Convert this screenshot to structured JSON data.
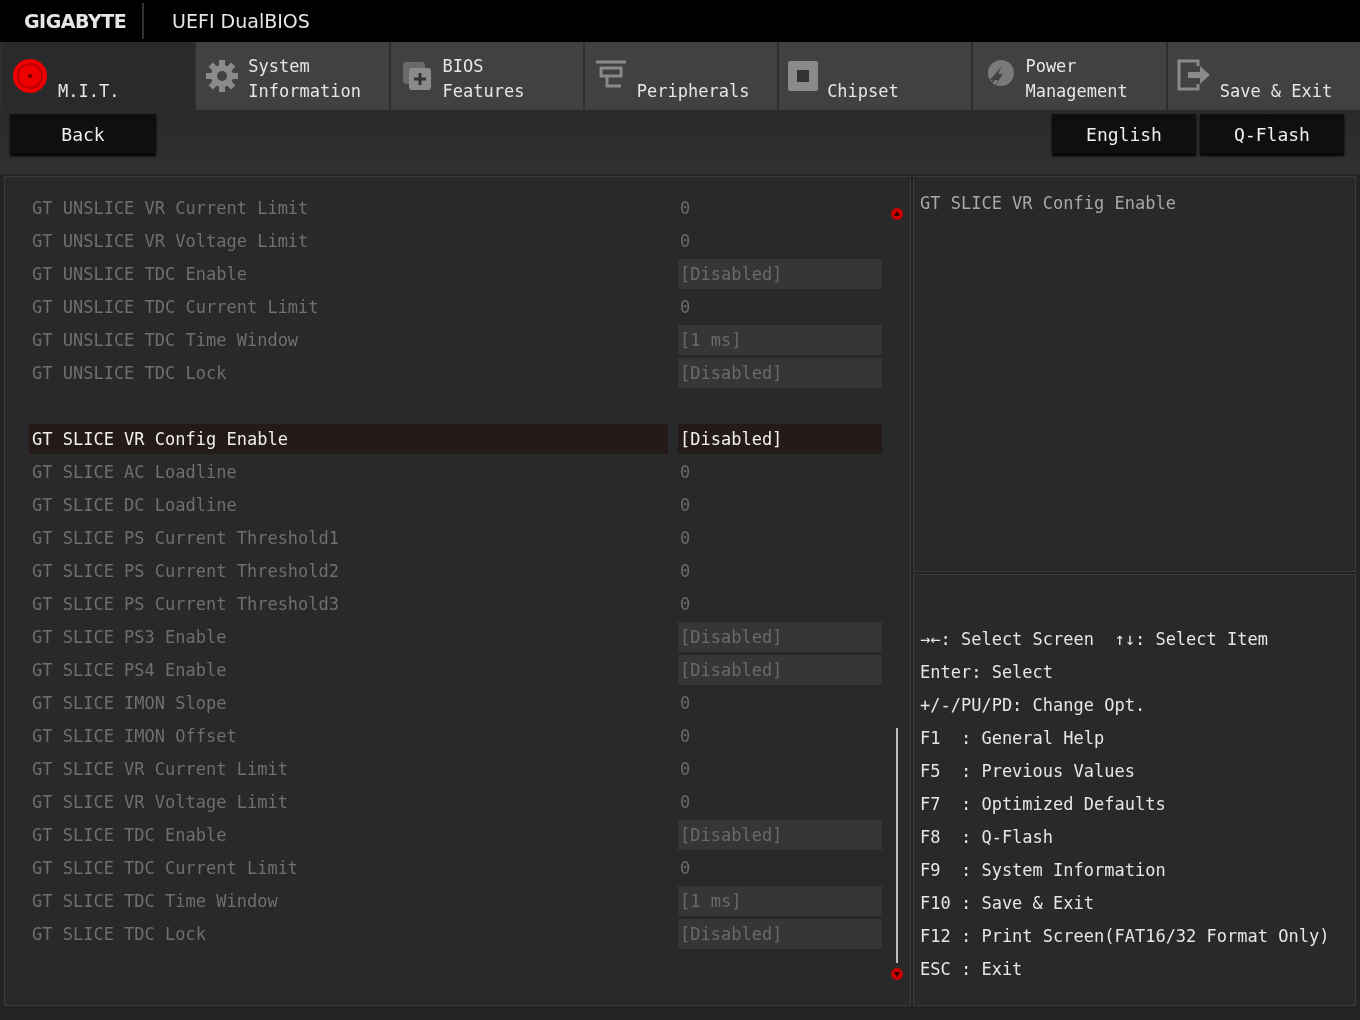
{
  "header": {
    "brand": "GIGABYTE",
    "title": "UEFI DualBIOS"
  },
  "tabs": [
    {
      "kind": "mit",
      "label": "M.I.T.",
      "selected": true
    },
    {
      "kind": "system",
      "label": "System Information",
      "selected": false
    },
    {
      "kind": "bios",
      "label": "BIOS Features",
      "selected": false
    },
    {
      "kind": "peripherals",
      "label": "Peripherals",
      "selected": false
    },
    {
      "kind": "chipset",
      "label": "Chipset",
      "selected": false
    },
    {
      "kind": "power",
      "label": "Power Management",
      "selected": false
    },
    {
      "kind": "exit",
      "label": "Save & Exit",
      "selected": false
    }
  ],
  "back_button": "Back",
  "top_buttons": [
    "English",
    "Q-Flash"
  ],
  "settings": [
    [
      {
        "label": "GT UNSLICE VR Current Limit",
        "value": "0",
        "kind": "number",
        "selected": false
      },
      {
        "label": "GT UNSLICE VR Voltage Limit",
        "value": "0",
        "kind": "number",
        "selected": false
      },
      {
        "label": "GT UNSLICE TDC Enable",
        "value": "[Disabled]",
        "kind": "option",
        "selected": false
      },
      {
        "label": "GT UNSLICE TDC Current Limit",
        "value": "0",
        "kind": "number",
        "selected": false
      },
      {
        "label": "GT UNSLICE TDC Time Window",
        "value": "[1 ms]",
        "kind": "option",
        "selected": false
      },
      {
        "label": "GT UNSLICE TDC Lock",
        "value": "[Disabled]",
        "kind": "option",
        "selected": false
      }
    ],
    [
      {
        "label": "GT SLICE VR Config Enable",
        "value": "[Disabled]",
        "kind": "option",
        "selected": true
      },
      {
        "label": "GT SLICE AC Loadline",
        "value": "0",
        "kind": "number",
        "selected": false
      },
      {
        "label": "GT SLICE DC Loadline",
        "value": "0",
        "kind": "number",
        "selected": false
      },
      {
        "label": "GT SLICE PS Current Threshold1",
        "value": "0",
        "kind": "number",
        "selected": false
      },
      {
        "label": "GT SLICE PS Current Threshold2",
        "value": "0",
        "kind": "number",
        "selected": false
      },
      {
        "label": "GT SLICE PS Current Threshold3",
        "value": "0",
        "kind": "number",
        "selected": false
      },
      {
        "label": "GT SLICE PS3 Enable",
        "value": "[Disabled]",
        "kind": "option",
        "selected": false
      },
      {
        "label": "GT SLICE PS4 Enable",
        "value": "[Disabled]",
        "kind": "option",
        "selected": false
      },
      {
        "label": "GT SLICE IMON Slope",
        "value": "0",
        "kind": "number",
        "selected": false
      },
      {
        "label": "GT SLICE IMON Offset",
        "value": "0",
        "kind": "number",
        "selected": false
      },
      {
        "label": "GT SLICE VR Current Limit",
        "value": "0",
        "kind": "number",
        "selected": false
      },
      {
        "label": "GT SLICE VR Voltage Limit",
        "value": "0",
        "kind": "number",
        "selected": false
      },
      {
        "label": "GT SLICE TDC Enable",
        "value": "[Disabled]",
        "kind": "option",
        "selected": false
      },
      {
        "label": "GT SLICE TDC Current Limit",
        "value": "0",
        "kind": "number",
        "selected": false
      },
      {
        "label": "GT SLICE TDC Time Window",
        "value": "[1 ms]",
        "kind": "option",
        "selected": false
      },
      {
        "label": "GT SLICE TDC Lock",
        "value": "[Disabled]",
        "kind": "option",
        "selected": false
      }
    ]
  ],
  "help_title": "GT SLICE VR Config Enable",
  "key_help": [
    "→←: Select Screen  ↑↓: Select Item",
    "Enter: Select",
    "+/-/PU/PD: Change Opt.",
    "F1  : General Help",
    "F5  : Previous Values",
    "F7  : Optimized Defaults",
    "F8  : Q-Flash",
    "F9  : System Information",
    "F10 : Save & Exit",
    "F12 : Print Screen(FAT16/32 Format Only)",
    "ESC : Exit"
  ]
}
